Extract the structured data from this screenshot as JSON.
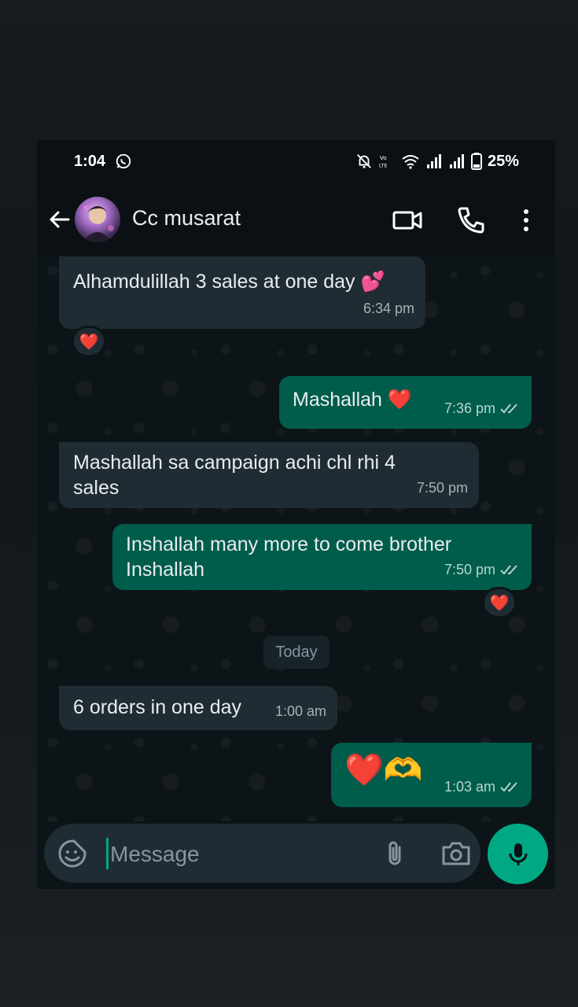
{
  "status_bar": {
    "time": "1:04",
    "battery": "25%",
    "icons": [
      "whatsapp-icon",
      "mute-bell-icon",
      "volte-icon",
      "wifi-icon",
      "signal-icon",
      "signal-icon",
      "battery-icon"
    ]
  },
  "header": {
    "contact_name": "Cc musarat",
    "icons": [
      "back-arrow-icon",
      "avatar",
      "video-call-icon",
      "phone-icon",
      "more-vert-icon"
    ]
  },
  "messages": [
    {
      "direction": "in",
      "text": "Alhamdulillah 3 sales at one day 💕",
      "time": "6:34 pm",
      "reaction": "❤️"
    },
    {
      "direction": "out",
      "text": "Mashallah ❤️",
      "time": "7:36 pm",
      "status": "read"
    },
    {
      "direction": "in",
      "text": "Mashallah sa campaign achi chl rhi 4 sales",
      "time": "7:50 pm"
    },
    {
      "direction": "out",
      "text": "Inshallah many more to come brother Inshallah",
      "time": "7:50 pm",
      "status": "read",
      "reaction": "❤️"
    },
    {
      "direction": "in",
      "text": "6 orders in one day",
      "time": "1:00 am"
    },
    {
      "direction": "out",
      "text": "❤️🫶",
      "time": "1:03 am",
      "status": "read"
    }
  ],
  "date_separator": "Today",
  "composer": {
    "placeholder": "Message",
    "icons": [
      "emoji-sticker-icon",
      "attach-icon",
      "camera-icon",
      "mic-icon"
    ]
  },
  "colors": {
    "incoming_bubble": "#202c33",
    "outgoing_bubble": "#005c4b",
    "accent": "#00a884",
    "chat_background": "#0d1417"
  }
}
